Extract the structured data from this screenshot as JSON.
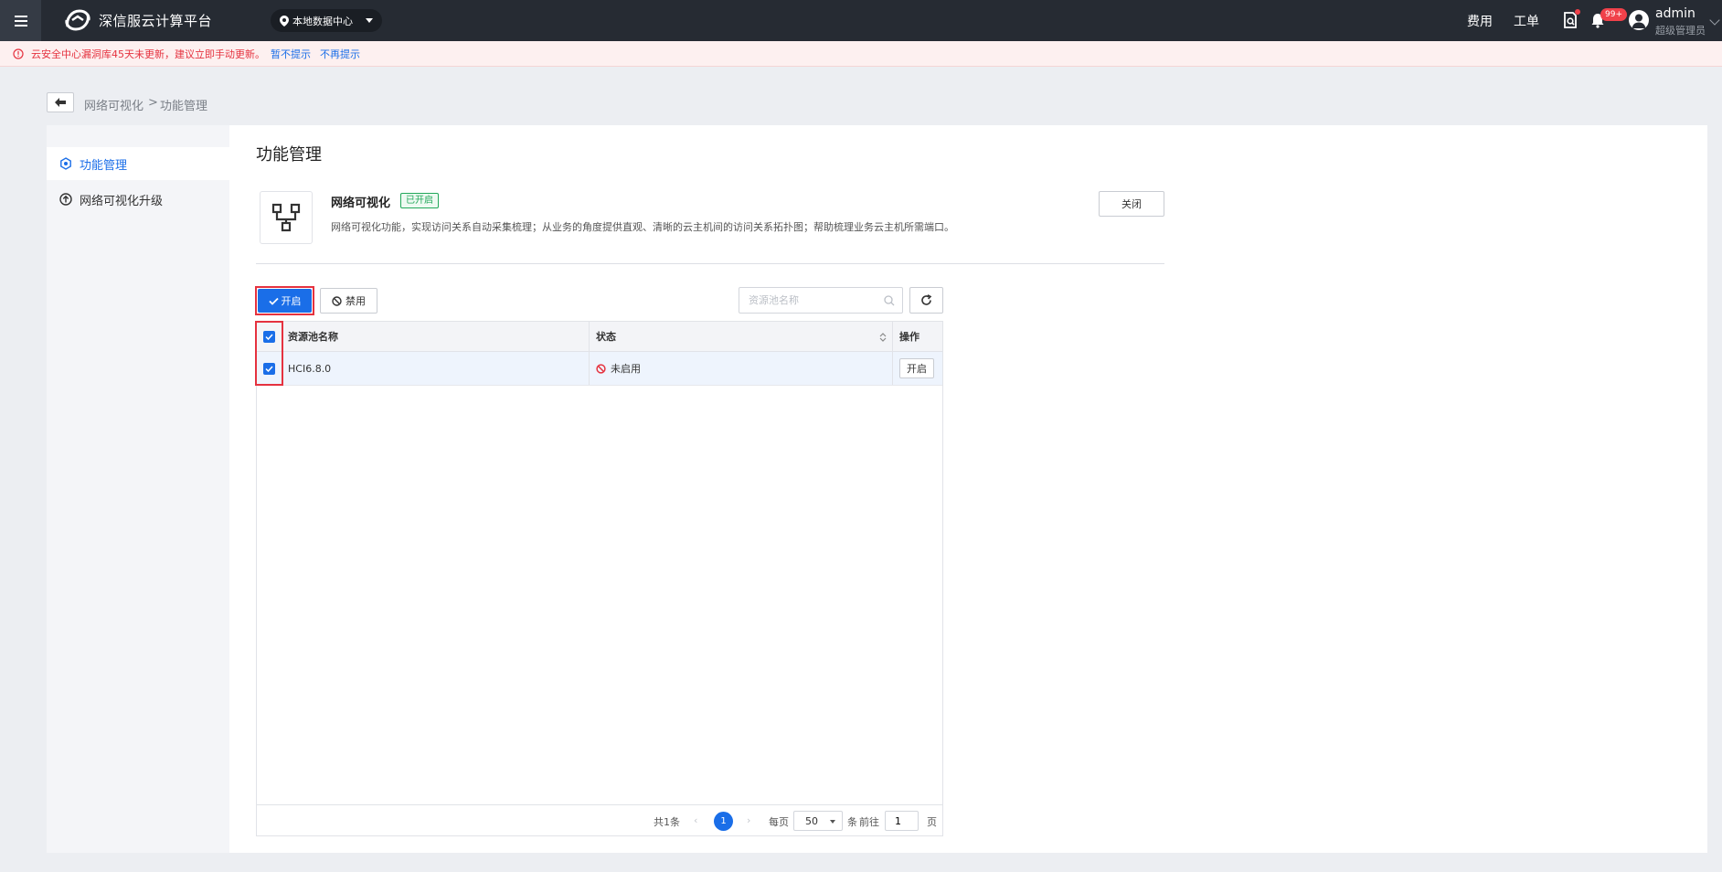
{
  "header": {
    "platform_name": "深信服云计算平台",
    "datacenter": "本地数据中心",
    "link_billing": "费用",
    "link_ticket": "工单",
    "badge_count": "99+",
    "user_name": "admin",
    "user_role": "超级管理员"
  },
  "alert": {
    "text": "云安全中心漏洞库45天未更新，建议立即手动更新。",
    "link_later": "暂不提示",
    "link_never": "不再提示"
  },
  "breadcrumb": {
    "parent": "网络可视化",
    "separator": ">",
    "current": "功能管理"
  },
  "sidebar": {
    "items": [
      {
        "label": "功能管理",
        "active": true
      },
      {
        "label": "网络可视化升级",
        "active": false
      }
    ]
  },
  "main": {
    "title": "功能管理",
    "feature": {
      "name": "网络可视化",
      "status_tag": "已开启",
      "description": "网络可视化功能，实现访问关系自动采集梳理；从业务的角度提供直观、清晰的云主机间的访问关系拓扑图；帮助梳理业务云主机所需端口。",
      "close_label": "关闭"
    },
    "toolbar": {
      "enable_label": "开启",
      "disable_label": "禁用",
      "search_placeholder": "资源池名称"
    },
    "table": {
      "columns": [
        "资源池名称",
        "状态",
        "操作"
      ],
      "rows": [
        {
          "name": "HCI6.8.0",
          "status": "未启用",
          "action": "开启",
          "checked": true
        }
      ]
    },
    "pager": {
      "total": "共1条",
      "current_page": "1",
      "per_page_label": "每页",
      "per_page": "50",
      "unit": "条",
      "goto_label": "前往",
      "goto_value": "1",
      "page_label": "页"
    }
  },
  "colors": {
    "topbar": "#262b33",
    "primary": "#1a6ee8",
    "danger": "#e5323f",
    "success": "#22a85a"
  }
}
